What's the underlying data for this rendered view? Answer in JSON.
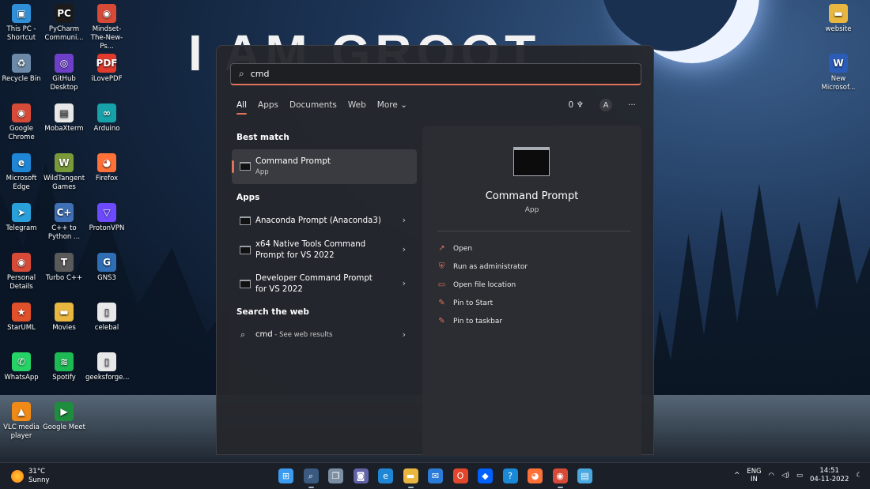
{
  "wallpaper": {
    "text": "I AM GROOT"
  },
  "desktop_icons": [
    {
      "name": "this-pc-shortcut",
      "label": "This PC - Shortcut",
      "glyph": "▣",
      "color": "#2f8fd8"
    },
    {
      "name": "pycharm",
      "label": "PyCharm Communi...",
      "glyph": "PC",
      "color": "#1b1b1b"
    },
    {
      "name": "mindset-chrome",
      "label": "Mindset-The-New-Ps...",
      "glyph": "◉",
      "color": "#d84a38"
    },
    {
      "name": "website-folder",
      "label": "website",
      "glyph": "▬",
      "color": "#e9b640"
    },
    {
      "name": "recycle-bin",
      "label": "Recycle Bin",
      "glyph": "♻",
      "color": "#6c8aa8"
    },
    {
      "name": "github-desktop",
      "label": "GitHub Desktop",
      "glyph": "◎",
      "color": "#6e40c9"
    },
    {
      "name": "ilovepdf",
      "label": "iLovePDF",
      "glyph": "PDF",
      "color": "#e23b2e"
    },
    {
      "name": "new-word-doc",
      "label": "New Microsof...",
      "glyph": "W",
      "color": "#2b5cb8"
    },
    {
      "name": "google-chrome",
      "label": "Google Chrome",
      "glyph": "◉",
      "color": "#d84a38"
    },
    {
      "name": "mobaxterm",
      "label": "MobaXterm",
      "glyph": "▤",
      "color": "#e8e8e8"
    },
    {
      "name": "arduino",
      "label": "Arduino",
      "glyph": "∞",
      "color": "#17a1a8"
    },
    {
      "name": "microsoft-edge",
      "label": "Microsoft Edge",
      "glyph": "e",
      "color": "#1f86d6"
    },
    {
      "name": "wildtangent-games",
      "label": "WildTangent Games",
      "glyph": "W",
      "color": "#7a9a3a"
    },
    {
      "name": "firefox",
      "label": "Firefox",
      "glyph": "◕",
      "color": "#ff7139"
    },
    {
      "name": "telegram",
      "label": "Telegram",
      "glyph": "➤",
      "color": "#2aa0da"
    },
    {
      "name": "cpp-to-python",
      "label": "C++ to Python ...",
      "glyph": "C+",
      "color": "#3f6fb5"
    },
    {
      "name": "protonvpn",
      "label": "ProtonVPN",
      "glyph": "▽",
      "color": "#6d4aff"
    },
    {
      "name": "personal-details",
      "label": "Personal Details",
      "glyph": "◉",
      "color": "#d84a38"
    },
    {
      "name": "turbo-cpp",
      "label": "Turbo C++",
      "glyph": "T",
      "color": "#5a5a5a"
    },
    {
      "name": "gns3",
      "label": "GNS3",
      "glyph": "G",
      "color": "#2f6db5"
    },
    {
      "name": "staruml",
      "label": "StarUML",
      "glyph": "★",
      "color": "#e0502a"
    },
    {
      "name": "movies-folder",
      "label": "Movies",
      "glyph": "▬",
      "color": "#e9b640"
    },
    {
      "name": "celebal-file",
      "label": "celebal",
      "glyph": "▯",
      "color": "#e8e8e8"
    },
    {
      "name": "whatsapp",
      "label": "WhatsApp",
      "glyph": "✆",
      "color": "#25d366"
    },
    {
      "name": "spotify",
      "label": "Spotify",
      "glyph": "≋",
      "color": "#1db954"
    },
    {
      "name": "geeksforge-file",
      "label": "geeksforge...",
      "glyph": "▯",
      "color": "#e8e8e8"
    },
    {
      "name": "vlc-media-player",
      "label": "VLC media player",
      "glyph": "▲",
      "color": "#f08a16"
    },
    {
      "name": "google-meet",
      "label": "Google Meet",
      "glyph": "▶",
      "color": "#1e8e3e"
    }
  ],
  "search": {
    "query": "cmd",
    "tabs": [
      {
        "label": "All",
        "active": true
      },
      {
        "label": "Apps"
      },
      {
        "label": "Documents"
      },
      {
        "label": "Web"
      },
      {
        "label": "More ⌄"
      }
    ],
    "points": "0",
    "avatar": "A",
    "more_dots": "···"
  },
  "best_match": {
    "title": "Best match",
    "item": {
      "name": "Command Prompt",
      "type": "App"
    }
  },
  "apps": {
    "title": "Apps",
    "items": [
      {
        "label": "Anaconda Prompt (Anaconda3)"
      },
      {
        "label": "x64 Native Tools Command Prompt for VS 2022"
      },
      {
        "label": "Developer Command Prompt for VS 2022"
      }
    ]
  },
  "web": {
    "title": "Search the web",
    "query": "cmd",
    "suffix": " - See web results"
  },
  "detail": {
    "title": "Command Prompt",
    "subtitle": "App",
    "actions": [
      {
        "label": "Open",
        "icon": "open-external-icon",
        "glyph": "↗"
      },
      {
        "label": "Run as administrator",
        "icon": "shield-admin-icon",
        "glyph": "⛨"
      },
      {
        "label": "Open file location",
        "icon": "folder-icon",
        "glyph": "▭"
      },
      {
        "label": "Pin to Start",
        "icon": "pin-icon",
        "glyph": "✎"
      },
      {
        "label": "Pin to taskbar",
        "icon": "pin-taskbar-icon",
        "glyph": "✎"
      }
    ]
  },
  "taskbar": {
    "weather": {
      "temp": "31°C",
      "condition": "Sunny"
    },
    "apps": [
      {
        "name": "start-button",
        "glyph": "⊞",
        "color": "#3a9bf0"
      },
      {
        "name": "search-taskbar",
        "glyph": "⌕",
        "color": "#3a5a80",
        "active": true
      },
      {
        "name": "task-view",
        "glyph": "❐",
        "color": "#7d8fa3"
      },
      {
        "name": "teams-chat",
        "glyph": "◙",
        "color": "#6264a7"
      },
      {
        "name": "edge-taskbar",
        "glyph": "e",
        "color": "#1f86d6"
      },
      {
        "name": "file-explorer",
        "glyph": "▬",
        "color": "#e9b640",
        "active": true
      },
      {
        "name": "mail",
        "glyph": "✉",
        "color": "#2b7bd8"
      },
      {
        "name": "office",
        "glyph": "O",
        "color": "#e2472b"
      },
      {
        "name": "dropbox",
        "glyph": "◆",
        "color": "#0061fe"
      },
      {
        "name": "help",
        "glyph": "?",
        "color": "#1a8ad8"
      },
      {
        "name": "firefox-taskbar",
        "glyph": "◕",
        "color": "#ff7139"
      },
      {
        "name": "chrome-taskbar",
        "glyph": "◉",
        "color": "#d84a38",
        "active": true
      },
      {
        "name": "notepad",
        "glyph": "▤",
        "color": "#4aa8e0"
      }
    ],
    "tray": {
      "chevron": "^",
      "lang_top": "ENG",
      "lang_bottom": "IN",
      "time": "14:51",
      "date": "04-11-2022"
    }
  }
}
